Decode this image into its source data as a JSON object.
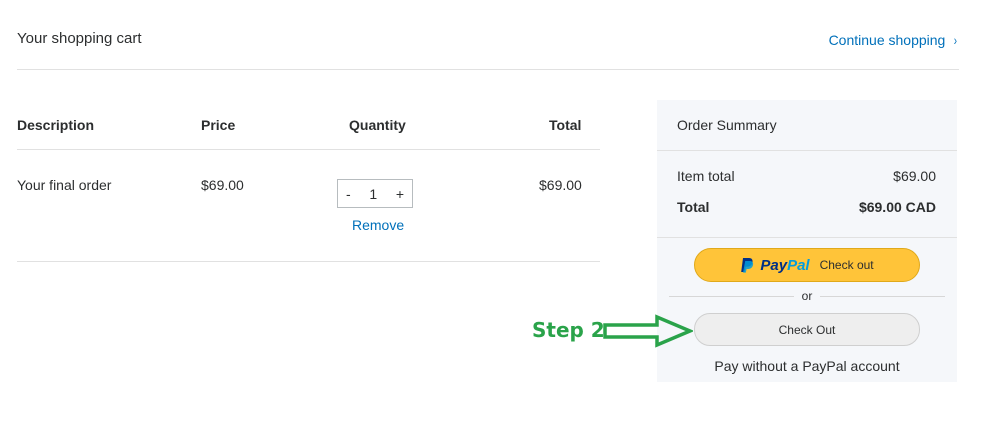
{
  "header": {
    "title": "Your shopping cart",
    "continue_label": "Continue shopping",
    "continue_icon": "chevron-right-icon"
  },
  "table": {
    "columns": [
      "Description",
      "Price",
      "Quantity",
      "Total"
    ],
    "rows": [
      {
        "description": "Your final order",
        "price": "$69.00",
        "quantity": "1",
        "total": "$69.00",
        "minus": "-",
        "plus": "+",
        "remove_label": "Remove"
      }
    ]
  },
  "summary": {
    "heading": "Order Summary",
    "item_total_label": "Item total",
    "item_total_value": "$69.00",
    "total_label": "Total",
    "total_value": "$69.00 CAD",
    "paypal_logo_pay": "Pay",
    "paypal_logo_pal": "Pal",
    "paypal_button_text": "Check out",
    "or_text": "or",
    "checkout_button": "Check Out",
    "pay_without": "Pay without a PayPal account"
  },
  "annotation": {
    "label": "Step 2",
    "color": "#2aa34a"
  },
  "colors": {
    "link": "#0070ba",
    "paypal_yellow": "#ffc439",
    "summary_bg": "#f5f7fa"
  }
}
